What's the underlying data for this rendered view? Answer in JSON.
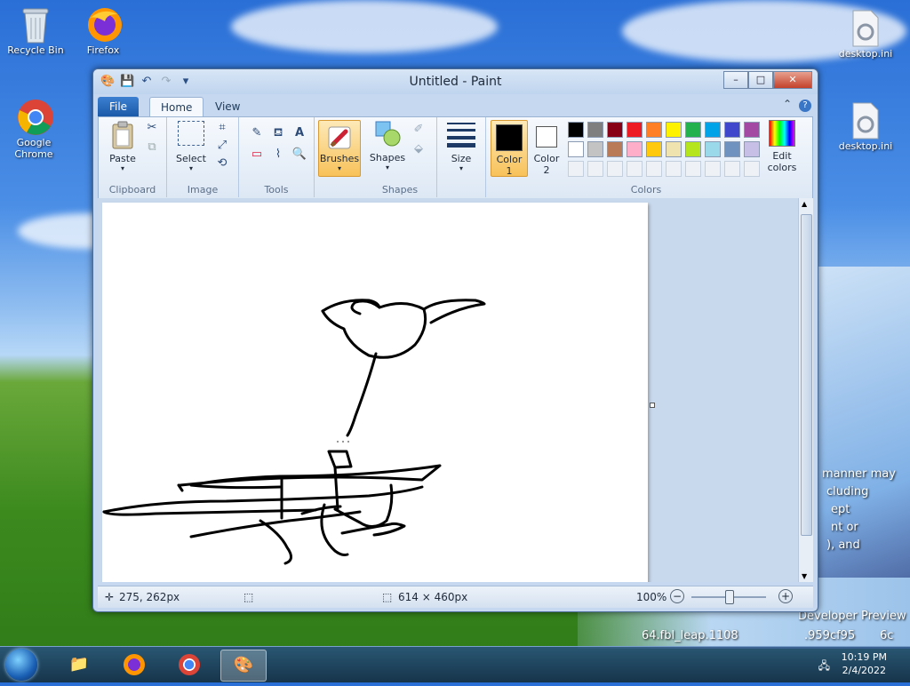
{
  "desktop": {
    "icons": [
      {
        "label": "Recycle Bin",
        "icon": "recycle-bin-icon"
      },
      {
        "label": "Firefox",
        "icon": "firefox-icon"
      },
      {
        "label": "Google Chrome",
        "icon": "chrome-icon"
      },
      {
        "label": "desktop.ini",
        "icon": "settings-file-icon"
      },
      {
        "label": "desktop.ini",
        "icon": "settings-file-icon"
      }
    ],
    "overlay_text": [
      "manner may",
      "cluding",
      "ept",
      "nt or",
      "), and",
      "Developer Preview",
      "64.fbl_leap.1108",
      ".959cf95",
      "6c"
    ]
  },
  "window": {
    "title": "Untitled - Paint",
    "buttons": {
      "minimize": "–",
      "maximize": "□",
      "close": "✕"
    }
  },
  "ribbon": {
    "tabs": [
      "File",
      "Home",
      "View"
    ],
    "groups": {
      "clipboard": {
        "label": "Clipboard",
        "paste": "Paste"
      },
      "image": {
        "label": "Image",
        "select": "Select"
      },
      "tools": {
        "label": "Tools"
      },
      "brushes": {
        "label": "Brushes"
      },
      "shapes": {
        "label": "Shapes",
        "shapes_btn": "Shapes"
      },
      "size": {
        "label": "Size"
      },
      "colors": {
        "label": "Colors",
        "color1": "Color 1",
        "color2": "Color 2",
        "edit": "Edit colors",
        "color1_value": "#000000",
        "color2_value": "#ffffff",
        "palette_row1": [
          "#000000",
          "#7f7f7f",
          "#880015",
          "#ed1c24",
          "#ff7f27",
          "#fff200",
          "#22b14c",
          "#00a2e8",
          "#3f48cc",
          "#a349a4"
        ],
        "palette_row2": [
          "#ffffff",
          "#c3c3c3",
          "#b97a57",
          "#ffaec9",
          "#ffc90e",
          "#efe4b0",
          "#b5e61d",
          "#99d9ea",
          "#7092be",
          "#c8bfe7"
        ]
      }
    }
  },
  "status": {
    "cursor": "275, 262px",
    "size": "614 × 460px",
    "zoom": "100%"
  },
  "taskbar": {
    "time": "10:19 PM",
    "date": "2/4/2022",
    "apps": [
      "explorer-icon",
      "firefox-icon",
      "chrome-icon",
      "paint-icon"
    ]
  }
}
